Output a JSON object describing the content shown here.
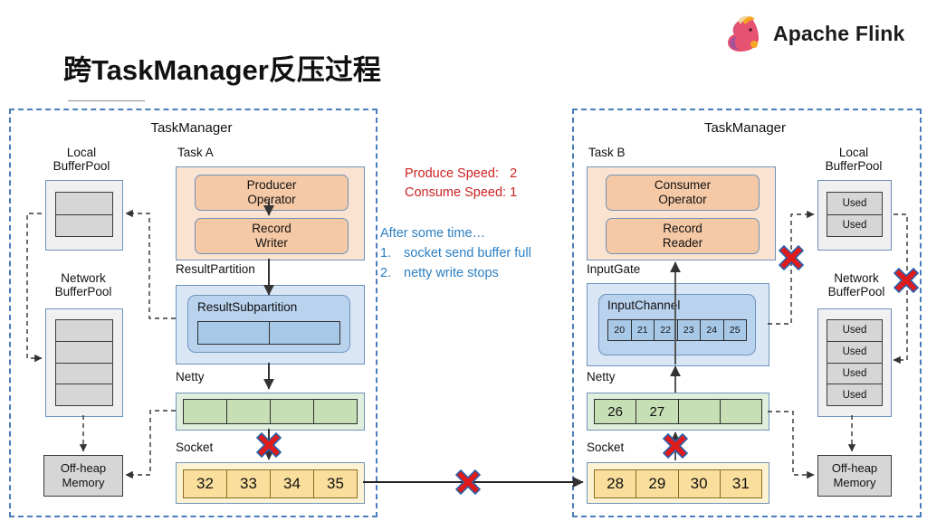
{
  "header": {
    "logo_icon": "flink-squirrel-icon",
    "brand": "Apache Flink",
    "brand_color": "#1b1b1b",
    "squirrel_color": "#e6526f",
    "squirrel_accent": "#f5a623"
  },
  "title": "跨TaskManager反压过程",
  "annotations": {
    "produce_speed_label": "Produce Speed:",
    "produce_speed_value": "2",
    "consume_speed_label": "Consume Speed:",
    "consume_speed_value": "1",
    "speed_color": "#cc2222",
    "note_heading": "After some time…",
    "note_color": "#2d7fc1",
    "notes": [
      {
        "num": "1.",
        "text": "socket send buffer full"
      },
      {
        "num": "2.",
        "text": "netty write stops"
      }
    ]
  },
  "left_taskmanager": {
    "title": "TaskManager",
    "local_bufferpool": {
      "label_line1": "Local",
      "label_line2": "BufferPool",
      "cells": [
        "",
        ""
      ]
    },
    "network_bufferpool": {
      "label_line1": "Network",
      "label_line2": "BufferPool",
      "cells": [
        "",
        "",
        "",
        ""
      ]
    },
    "offheap": {
      "line1": "Off-heap",
      "line2": "Memory"
    },
    "task": {
      "label": "Task A",
      "operator": {
        "line1": "Producer",
        "line2": "Operator"
      },
      "record": {
        "line1": "Record",
        "line2": "Writer"
      }
    },
    "result_partition": {
      "label": "ResultPartition",
      "subpartition_label": "ResultSubpartition",
      "cells": [
        "",
        ""
      ]
    },
    "netty": {
      "label": "Netty",
      "cells": [
        "",
        "",
        "",
        ""
      ]
    },
    "socket": {
      "label": "Socket",
      "cells": [
        "32",
        "33",
        "34",
        "35"
      ]
    }
  },
  "right_taskmanager": {
    "title": "TaskManager",
    "local_bufferpool": {
      "label_line1": "Local",
      "label_line2": "BufferPool",
      "cells": [
        "Used",
        "Used"
      ]
    },
    "network_bufferpool": {
      "label_line1": "Network",
      "label_line2": "BufferPool",
      "cells": [
        "Used",
        "Used",
        "Used",
        "Used"
      ]
    },
    "offheap": {
      "line1": "Off-heap",
      "line2": "Memory"
    },
    "task": {
      "label": "Task B",
      "operator": {
        "line1": "Consumer",
        "line2": "Operator"
      },
      "record": {
        "line1": "Record",
        "line2": "Reader"
      }
    },
    "input_gate": {
      "label": "InputGate",
      "channel_label": "InputChannel",
      "cells": [
        "20",
        "21",
        "22",
        "23",
        "24",
        "25"
      ]
    },
    "netty": {
      "label": "Netty",
      "cells": [
        "26",
        "27",
        "",
        ""
      ]
    },
    "socket": {
      "label": "Socket",
      "cells": [
        "28",
        "29",
        "30",
        "31"
      ]
    }
  },
  "blockers": {
    "icon": "red-x-icon",
    "color": "#e01b1b",
    "count": 5
  },
  "colors": {
    "frame_dashed": "#4a7ebb",
    "task_fill": "#fbe3d2",
    "operator_fill": "#f5c9a6",
    "partition_fill": "#d9e6f5",
    "channel_fill": "#a8c8e8",
    "netty_fill": "#c6dfb4",
    "socket_fill": "#fadf9c",
    "buffer_fill": "#d6d6d6"
  }
}
